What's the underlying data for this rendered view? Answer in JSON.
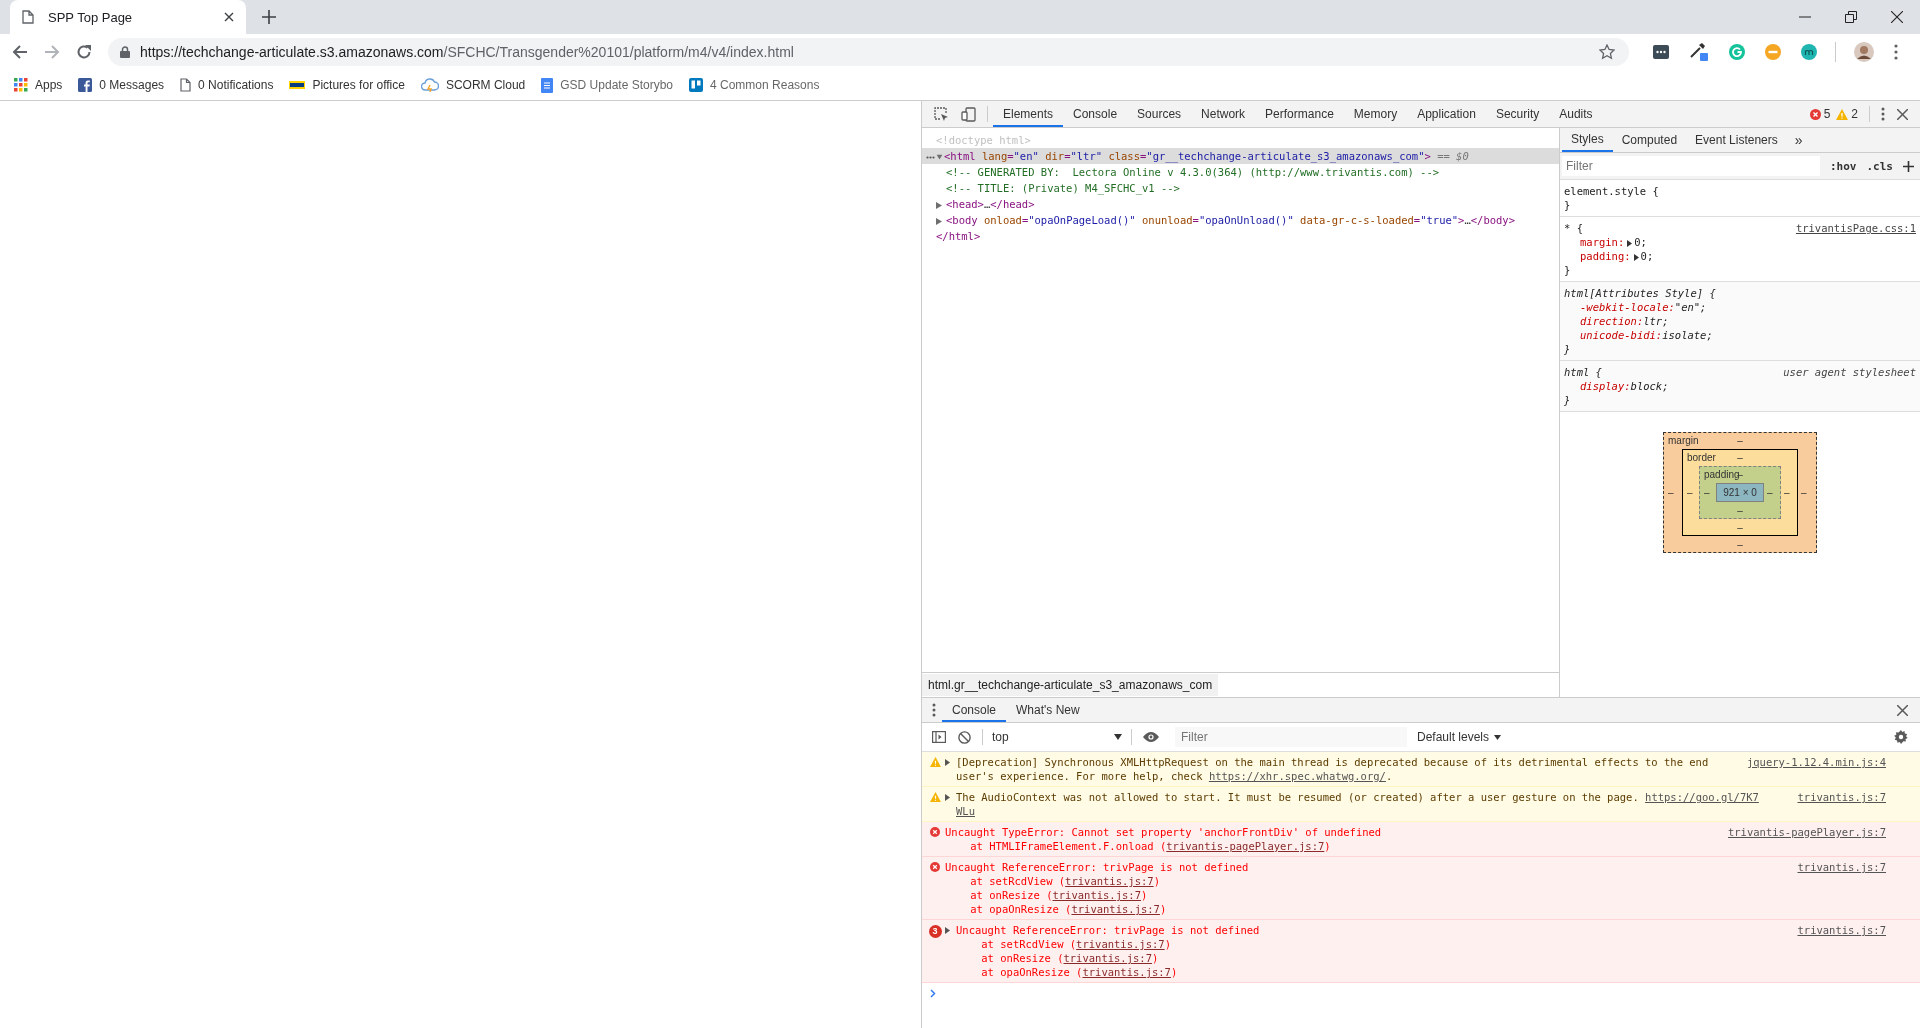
{
  "browser": {
    "tab": {
      "title": "SPP Top Page"
    },
    "address": {
      "host": "https://techchange-articulate.s3.amazonaws.com",
      "path": "/SFCHC/Transgender%20101/platform/m4/v4/index.html"
    },
    "bookmarks": [
      {
        "kind": "apps",
        "label": "Apps",
        "faded": false
      },
      {
        "kind": "facebook",
        "label": "0 Messages",
        "faded": false
      },
      {
        "kind": "page",
        "label": "0 Notifications",
        "faded": false
      },
      {
        "kind": "bar",
        "label": "Pictures for office",
        "faded": false
      },
      {
        "kind": "cloud",
        "label": "SCORM Cloud",
        "faded": false
      },
      {
        "kind": "doc",
        "label": "GSD Update Storybo",
        "faded": true
      },
      {
        "kind": "board",
        "label": "4 Common Reasons",
        "faded": true
      }
    ]
  },
  "devtools": {
    "tabs": [
      {
        "label": "Elements",
        "selected": true
      },
      {
        "label": "Console",
        "selected": false
      },
      {
        "label": "Sources",
        "selected": false
      },
      {
        "label": "Network",
        "selected": false
      },
      {
        "label": "Performance",
        "selected": false
      },
      {
        "label": "Memory",
        "selected": false
      },
      {
        "label": "Application",
        "selected": false
      },
      {
        "label": "Security",
        "selected": false
      },
      {
        "label": "Audits",
        "selected": false
      }
    ],
    "errors": "5",
    "warnings": "2",
    "dom": [
      {
        "kind": "doctype",
        "selected": false,
        "segments": [
          {
            "kind": "doctype",
            "text": "<!doctype html>"
          }
        ]
      },
      {
        "kind": "element",
        "selected": true,
        "expanded": true,
        "segments": [
          {
            "kind": "tag",
            "text": "<html"
          },
          {
            "kind": "attr",
            "text": " lang"
          },
          {
            "kind": "tag",
            "text": "="
          },
          {
            "kind": "value",
            "text": "\"en\""
          },
          {
            "kind": "attr",
            "text": " dir"
          },
          {
            "kind": "tag",
            "text": "="
          },
          {
            "kind": "value",
            "text": "\"ltr\""
          },
          {
            "kind": "attr",
            "text": " class"
          },
          {
            "kind": "tag",
            "text": "="
          },
          {
            "kind": "value",
            "text": "\"gr__techchange-articulate_s3_amazonaws_com\""
          },
          {
            "kind": "tag",
            "text": ">"
          },
          {
            "kind": "marker",
            "text": " == $0"
          }
        ],
        "children": [
          {
            "kind": "comment",
            "selected": false,
            "segments": [
              {
                "kind": "comment",
                "text": "<!-- GENERATED BY:  Lectora Online v 4.3.0(364) (http://www.trivantis.com) -->"
              }
            ]
          },
          {
            "kind": "comment",
            "selected": false,
            "segments": [
              {
                "kind": "comment",
                "text": "<!-- TITLE: (Private) M4_SFCHC_v1 -->"
              }
            ]
          },
          {
            "kind": "element",
            "selected": false,
            "expanded": false,
            "segments": [
              {
                "kind": "tag",
                "text": "<head>"
              },
              {
                "kind": "text",
                "text": "…"
              },
              {
                "kind": "tag",
                "text": "</head>"
              }
            ]
          },
          {
            "kind": "element",
            "selected": false,
            "expanded": false,
            "segments": [
              {
                "kind": "tag",
                "text": "<body"
              },
              {
                "kind": "attr",
                "text": " onload"
              },
              {
                "kind": "tag",
                "text": "="
              },
              {
                "kind": "value",
                "text": "\"opaOnPageLoad()\""
              },
              {
                "kind": "attr",
                "text": " onunload"
              },
              {
                "kind": "tag",
                "text": "="
              },
              {
                "kind": "value",
                "text": "\"opaOnUnload()\""
              },
              {
                "kind": "attr",
                "text": " data-gr-c-s-loaded"
              },
              {
                "kind": "tag",
                "text": "="
              },
              {
                "kind": "value",
                "text": "\"true\""
              },
              {
                "kind": "tag",
                "text": ">"
              },
              {
                "kind": "text",
                "text": "…"
              },
              {
                "kind": "tag",
                "text": "</body>"
              }
            ]
          }
        ],
        "close": "</html>"
      }
    ],
    "breadcrumb": "html.gr__techchange-articulate_s3_amazonaws_com",
    "styles_tabs": [
      {
        "label": "Styles",
        "selected": true
      },
      {
        "label": "Computed",
        "selected": false
      },
      {
        "label": "Event Listeners",
        "selected": false
      }
    ],
    "more_tabs": "»",
    "styles_filter": {
      "placeholder": "Filter"
    },
    "hov": ":hov",
    "cls": ".cls",
    "rules": [
      {
        "kind": "inline",
        "selector": "element.style {",
        "close": "}"
      },
      {
        "kind": "author",
        "selector": "* {",
        "source": "trivantisPage.css:1",
        "close": "}",
        "declarations": [
          {
            "name": "margin:",
            "value": "0;",
            "expandable": true
          },
          {
            "name": "padding:",
            "value": "0;",
            "expandable": true
          }
        ]
      },
      {
        "kind": "attributes",
        "selector": "html[Attributes Style] {",
        "close": "}",
        "declarations": [
          {
            "name": "-webkit-locale:",
            "value": "\"en\";",
            "expandable": false
          },
          {
            "name": "direction:",
            "value": "ltr;",
            "expandable": false
          },
          {
            "name": "unicode-bidi:",
            "value": "isolate;",
            "expandable": false
          }
        ]
      },
      {
        "kind": "useragent",
        "selector": "html {",
        "source": "user agent stylesheet",
        "close": "}",
        "declarations": [
          {
            "name": "display:",
            "value": "block;",
            "expandable": false
          }
        ]
      }
    ],
    "box_model": {
      "margin": {
        "label": "margin",
        "top": "–",
        "right": "–",
        "bottom": "–",
        "left": "–"
      },
      "border": {
        "label": "border",
        "top": "–",
        "right": "–",
        "bottom": "–",
        "left": "–"
      },
      "padding": {
        "label": "padding",
        "top": "–",
        "right": "–",
        "bottom": "–",
        "left": "–"
      },
      "content": "921 × 0"
    },
    "drawer": {
      "tabs": [
        {
          "label": "Console",
          "selected": true
        },
        {
          "label": "What's New",
          "selected": false
        }
      ],
      "context": "top",
      "filter": {
        "placeholder": "Filter"
      },
      "levels": "Default levels",
      "messages": [
        {
          "kind": "warning",
          "expandable": true,
          "source": "jquery-1.12.4.min.js:4",
          "lines": [
            [
              {
                "kind": "text",
                "text": "[Deprecation] Synchronous XMLHttpRequest on the main thread is deprecated because of its detrimental effects to the end"
              }
            ],
            [
              {
                "kind": "text",
                "text": "user's experience. For more help, check "
              },
              {
                "kind": "link",
                "text": "https://xhr.spec.whatwg.org/"
              },
              {
                "kind": "text",
                "text": "."
              }
            ]
          ]
        },
        {
          "kind": "warning",
          "expandable": true,
          "source": "trivantis.js:7",
          "lines": [
            [
              {
                "kind": "text",
                "text": "The AudioContext was not allowed to start. It must be resumed (or created) after a user gesture on the page. "
              },
              {
                "kind": "link",
                "text": "https://goo.gl/7K7"
              }
            ],
            [
              {
                "kind": "link",
                "text": "WLu"
              }
            ]
          ]
        },
        {
          "kind": "error",
          "expandable": false,
          "source": "trivantis-pagePlayer.js:7",
          "lines": [
            [
              {
                "kind": "text",
                "text": "Uncaught TypeError: Cannot set property 'anchorFrontDiv' of undefined"
              }
            ],
            [
              {
                "kind": "text",
                "text": "    at HTMLIFrameElement.F.onload ("
              },
              {
                "kind": "link",
                "text": "trivantis-pagePlayer.js:7"
              },
              {
                "kind": "text",
                "text": ")"
              }
            ]
          ]
        },
        {
          "kind": "error",
          "expandable": false,
          "source": "trivantis.js:7",
          "lines": [
            [
              {
                "kind": "text",
                "text": "Uncaught ReferenceError: trivPage is not defined"
              }
            ],
            [
              {
                "kind": "text",
                "text": "    at setRcdView ("
              },
              {
                "kind": "link",
                "text": "trivantis.js:7"
              },
              {
                "kind": "text",
                "text": ")"
              }
            ],
            [
              {
                "kind": "text",
                "text": "    at onResize ("
              },
              {
                "kind": "link",
                "text": "trivantis.js:7"
              },
              {
                "kind": "text",
                "text": ")"
              }
            ],
            [
              {
                "kind": "text",
                "text": "    at opaOnResize ("
              },
              {
                "kind": "link",
                "text": "trivantis.js:7"
              },
              {
                "kind": "text",
                "text": ")"
              }
            ]
          ]
        },
        {
          "kind": "error",
          "expandable": true,
          "count": "3",
          "source": "trivantis.js:7",
          "lines": [
            [
              {
                "kind": "text",
                "text": "Uncaught ReferenceError: trivPage is not defined"
              }
            ],
            [
              {
                "kind": "text",
                "text": "    at setRcdView ("
              },
              {
                "kind": "link",
                "text": "trivantis.js:7"
              },
              {
                "kind": "text",
                "text": ")"
              }
            ],
            [
              {
                "kind": "text",
                "text": "    at onResize ("
              },
              {
                "kind": "link",
                "text": "trivantis.js:7"
              },
              {
                "kind": "text",
                "text": ")"
              }
            ],
            [
              {
                "kind": "text",
                "text": "    at opaOnResize ("
              },
              {
                "kind": "link",
                "text": "trivantis.js:7"
              },
              {
                "kind": "text",
                "text": ")"
              }
            ]
          ]
        }
      ]
    }
  }
}
